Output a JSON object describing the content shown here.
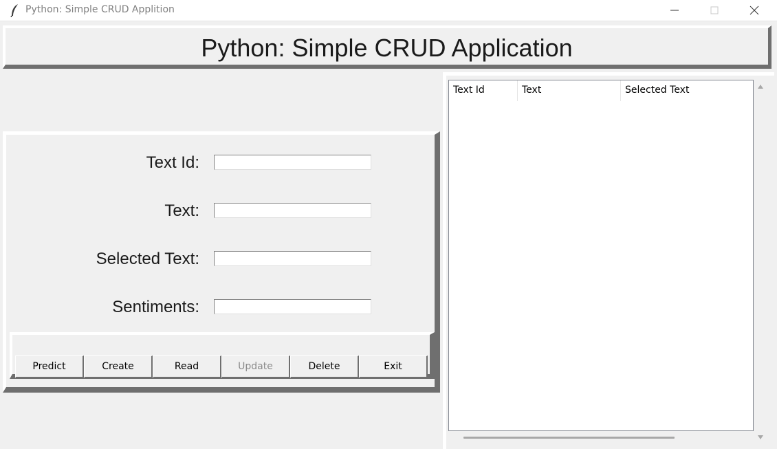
{
  "window": {
    "title": "Python: Simple CRUD Applition",
    "app_icon": "feather-icon",
    "controls": [
      "minimize-icon",
      "maximize-icon",
      "close-icon"
    ]
  },
  "header": {
    "title": "Python: Simple CRUD Application"
  },
  "form": {
    "fields": [
      {
        "label": "Text Id:",
        "value": ""
      },
      {
        "label": "Text:",
        "value": ""
      },
      {
        "label": "Selected Text:",
        "value": ""
      },
      {
        "label": "Sentiments:",
        "value": ""
      }
    ]
  },
  "buttons": [
    {
      "label": "Predict",
      "enabled": true
    },
    {
      "label": "Create",
      "enabled": true
    },
    {
      "label": "Read",
      "enabled": true
    },
    {
      "label": "Update",
      "enabled": false
    },
    {
      "label": "Delete",
      "enabled": true
    },
    {
      "label": "Exit",
      "enabled": true
    }
  ],
  "table": {
    "columns": [
      "Text Id",
      "Text",
      "Selected Text"
    ],
    "rows": []
  },
  "colors": {
    "background": "#f0f0f0",
    "bevel_light": "#ffffff",
    "bevel_dark": "#6f6f6f",
    "disabled_text": "#8a8a8a"
  }
}
